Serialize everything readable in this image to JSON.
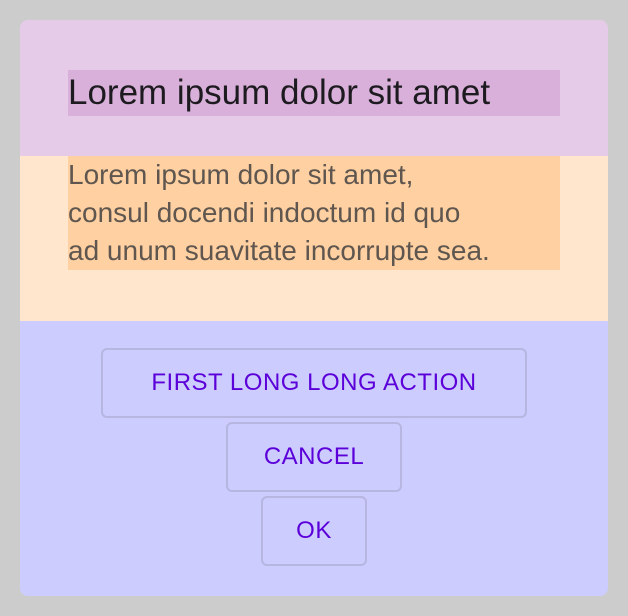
{
  "dialog": {
    "title": "Lorem ipsum dolor sit amet",
    "body_lines": [
      "Lorem ipsum dolor sit amet,",
      "consul docendi indoctum id quo",
      "ad unum suavitate incorrupte sea."
    ],
    "actions": {
      "first_label": "FIRST LONG LONG ACTION",
      "cancel_label": "CANCEL",
      "ok_label": "OK"
    }
  },
  "colors": {
    "backdrop": "#cccccc",
    "title_section": "#e5cbe8",
    "title_highlight": "#d8b0d9",
    "body_section": "#ffe6cc",
    "body_highlight": "#ffd0a1",
    "actions_section": "#ccccff",
    "button_text": "#5b00d9",
    "button_border": "#b6b6e0"
  }
}
